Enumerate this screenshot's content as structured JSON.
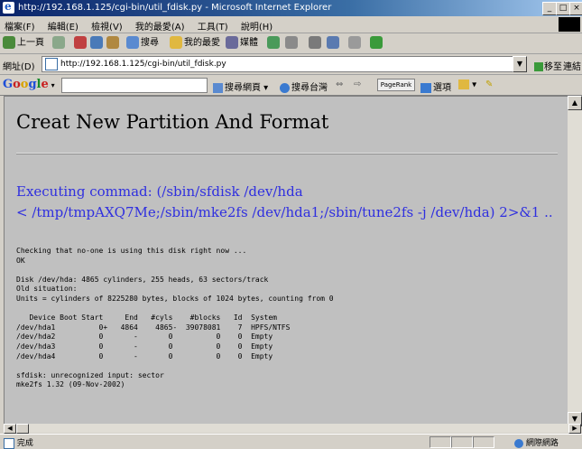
{
  "window": {
    "title": "http://192.168.1.125/cgi-bin/util_fdisk.py - Microsoft Internet Explorer",
    "min_btn": "_",
    "max_btn": "□",
    "close_btn": "×"
  },
  "menu": {
    "items": [
      "檔案(F)",
      "編輯(E)",
      "檢視(V)",
      "我的最愛(A)",
      "工具(T)",
      "說明(H)"
    ]
  },
  "toolbar": {
    "back": "上一頁",
    "search": "搜尋",
    "favorites": "我的最愛",
    "media": "媒體"
  },
  "address": {
    "label": "網址(D)",
    "url": "http://192.168.1.125/cgi-bin/util_fdisk.py",
    "go": "移至",
    "links": "連結"
  },
  "googlebar": {
    "logo_parts": [
      "G",
      "o",
      "o",
      "g",
      "l",
      "e"
    ],
    "search_web": "搜尋網頁",
    "search_tw": "搜尋台灣",
    "pagerank": "PageRank",
    "options": "選項"
  },
  "page": {
    "heading": "Creat New Partition And Format",
    "exec_line1": "Executing commad: (/sbin/sfdisk /dev/hda",
    "exec_line2": "< /tmp/tmpAXQ7Me;/sbin/mke2fs /dev/hda1;/sbin/tune2fs -j /dev/hda) 2>&1 ..",
    "output": "Checking that no-one is using this disk right now ...\nOK\n\nDisk /dev/hda: 4865 cylinders, 255 heads, 63 sectors/track\nOld situation:\nUnits = cylinders of 8225280 bytes, blocks of 1024 bytes, counting from 0\n\n   Device Boot Start     End   #cyls    #blocks   Id  System\n/dev/hda1          0+   4864    4865-  39078081    7  HPFS/NTFS\n/dev/hda2          0       -       0          0    0  Empty\n/dev/hda3          0       -       0          0    0  Empty\n/dev/hda4          0       -       0          0    0  Empty\n\nsfdisk: unrecognized input: sector\nmke2fs 1.32 (09-Nov-2002)"
  },
  "status": {
    "done": "完成",
    "zone": "網際網路"
  }
}
